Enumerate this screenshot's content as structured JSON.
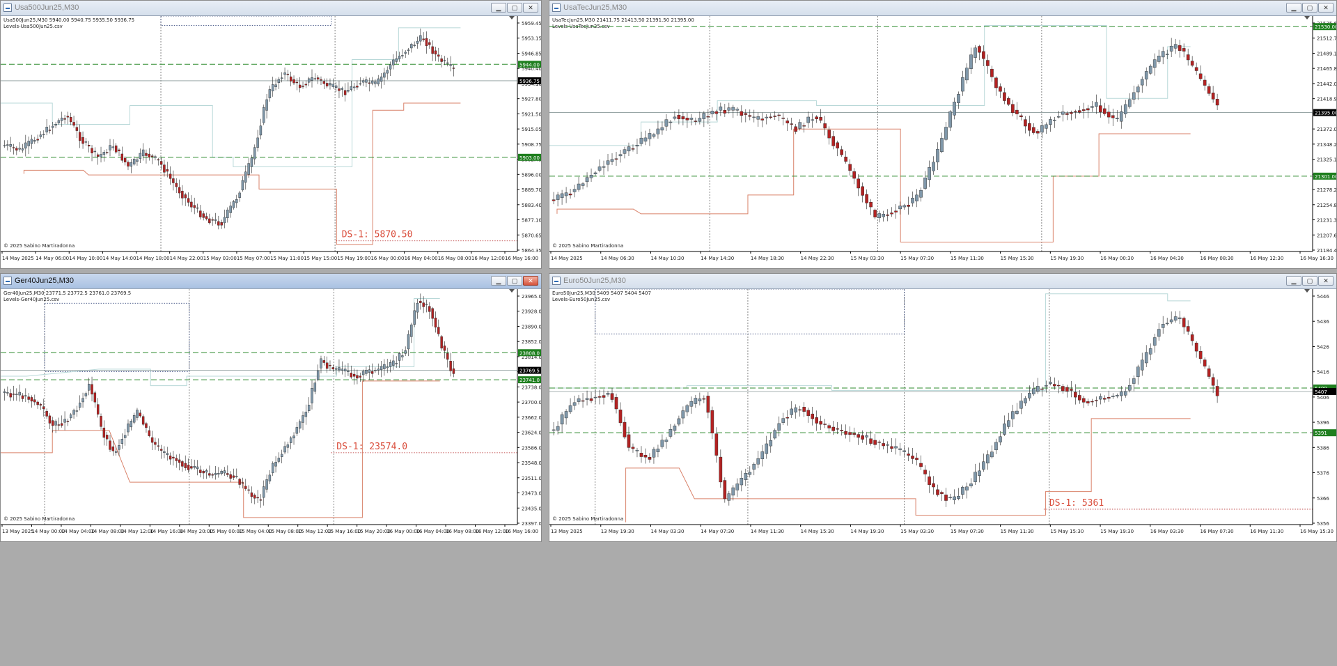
{
  "copyright": "© 2025 Sabino Martiradonna",
  "colors": {
    "bull": "#7F97A9",
    "bear": "#B22222",
    "level": "#2E8B2E",
    "redline": "#D9826A",
    "cyanline": "#B8D8D8",
    "price_line": "#8a9a9a",
    "tag_green": "#1F7F1F",
    "tag_black": "#000000"
  },
  "icons": {
    "minimize": "minimize-icon",
    "maximize": "maximize-icon",
    "close": "close-icon",
    "window": "chart-window-icon"
  },
  "charts": [
    {
      "id": "usa500",
      "title": "Usa500Jun25,M30",
      "header_line": "Usa500Jun25,M30  5940.00 5940.75 5935.50 5936.75",
      "indicator": "Levels-Usa500Jun25.csv",
      "price_ticks": [
        "5959.45",
        "5953.15",
        "5946.85",
        "5940.40",
        "5934.10",
        "5927.80",
        "5921.50",
        "5915.05",
        "5908.75",
        "5902.45",
        "5896.00",
        "5889.70",
        "5883.40",
        "5877.10",
        "5870.65",
        "5864.35"
      ],
      "time_ticks": [
        "14 May 2025",
        "14 May 06:00",
        "14 May 10:00",
        "14 May 14:00",
        "14 May 18:00",
        "14 May 22:00",
        "15 May 03:00",
        "15 May 07:00",
        "15 May 11:00",
        "15 May 15:00",
        "15 May 19:00",
        "16 May 00:00",
        "16 May 04:00",
        "16 May 08:00",
        "16 May 12:00",
        "16 May 16:00"
      ],
      "tags": [
        {
          "text": "5944.00",
          "kind": "green"
        },
        {
          "text": "5936.75",
          "kind": "black"
        },
        {
          "text": "5903.00",
          "kind": "green"
        }
      ],
      "ds_label": "DS-1: 5870.50",
      "active": false
    },
    {
      "id": "usatec",
      "title": "UsaTecJun25,M30",
      "header_line": "UsaTecJun25,M30  21411.75 21413.50 21391.50 21395.00",
      "indicator": "Levels-UsaTecJun25.csv",
      "price_ticks": [
        "21535.60",
        "21512.70",
        "21489.15",
        "21465.80",
        "21442.00",
        "21418.90",
        "21395.40",
        "21372.00",
        "21348.20",
        "21325.10",
        "21301.55",
        "21278.20",
        "21254.80",
        "21231.30",
        "21207.60",
        "21184.40"
      ],
      "time_ticks": [
        "14 May 2025",
        "14 May 06:30",
        "14 May 10:30",
        "14 May 14:30",
        "14 May 18:30",
        "14 May 22:30",
        "15 May 03:30",
        "15 May 07:30",
        "15 May 11:30",
        "15 May 15:30",
        "15 May 19:30",
        "16 May 00:30",
        "16 May 04:30",
        "16 May 08:30",
        "16 May 12:30",
        "16 May 16:30"
      ],
      "tags": [
        {
          "text": "21530.00",
          "kind": "green"
        },
        {
          "text": "21395.00",
          "kind": "black"
        },
        {
          "text": "21301.00",
          "kind": "green"
        }
      ],
      "ds_label": "",
      "active": false
    },
    {
      "id": "ger40",
      "title": "Ger40Jun25,M30",
      "header_line": "Ger40Jun25,M30  23771.5 23772.5 23761.0 23769.5",
      "indicator": "Levels-Ger40Jun25.csv",
      "price_ticks": [
        "23965.0",
        "23928.0",
        "23890.0",
        "23852.0",
        "23814.0",
        "23776.0",
        "23738.0",
        "23700.0",
        "23662.0",
        "23624.0",
        "23586.0",
        "23548.0",
        "23511.0",
        "23473.0",
        "23435.0",
        "23397.0"
      ],
      "time_ticks": [
        "13 May 2025",
        "14 May 00:00",
        "14 May 04:00",
        "14 May 08:00",
        "14 May 12:00",
        "14 May 16:00",
        "14 May 20:00",
        "15 May 00:00",
        "15 May 04:00",
        "15 May 08:00",
        "15 May 12:00",
        "15 May 16:00",
        "15 May 20:00",
        "16 May 00:00",
        "16 May 04:00",
        "16 May 08:00",
        "16 May 12:00",
        "16 May 16:00"
      ],
      "tags": [
        {
          "text": "23808.0",
          "kind": "green"
        },
        {
          "text": "23769.5",
          "kind": "black"
        },
        {
          "text": "23741.0",
          "kind": "green"
        }
      ],
      "ds_label": "DS-1: 23574.0",
      "active": true
    },
    {
      "id": "euro50",
      "title": "Euro50Jun25,M30",
      "header_line": "Euro50Jun25,M30  5409 5407 5404 5407",
      "indicator": "Levels-Euro50Jun25.csv",
      "price_ticks": [
        "5446",
        "5436",
        "5426",
        "5416",
        "5406",
        "5396",
        "5386",
        "5376",
        "5366",
        "5356"
      ],
      "time_ticks": [
        "13 May 2025",
        "13 May 19:30",
        "14 May 03:30",
        "14 May 07:30",
        "14 May 11:30",
        "14 May 15:30",
        "14 May 19:30",
        "15 May 03:30",
        "15 May 07:30",
        "15 May 11:30",
        "15 May 15:30",
        "15 May 19:30",
        "16 May 03:30",
        "16 May 07:30",
        "16 May 11:30",
        "16 May 15:30"
      ],
      "tags": [
        {
          "text": "5409",
          "kind": "green"
        },
        {
          "text": "5407",
          "kind": "black"
        },
        {
          "text": "5391",
          "kind": "green"
        }
      ],
      "ds_label": "DS-1: 5361",
      "active": false
    }
  ]
}
